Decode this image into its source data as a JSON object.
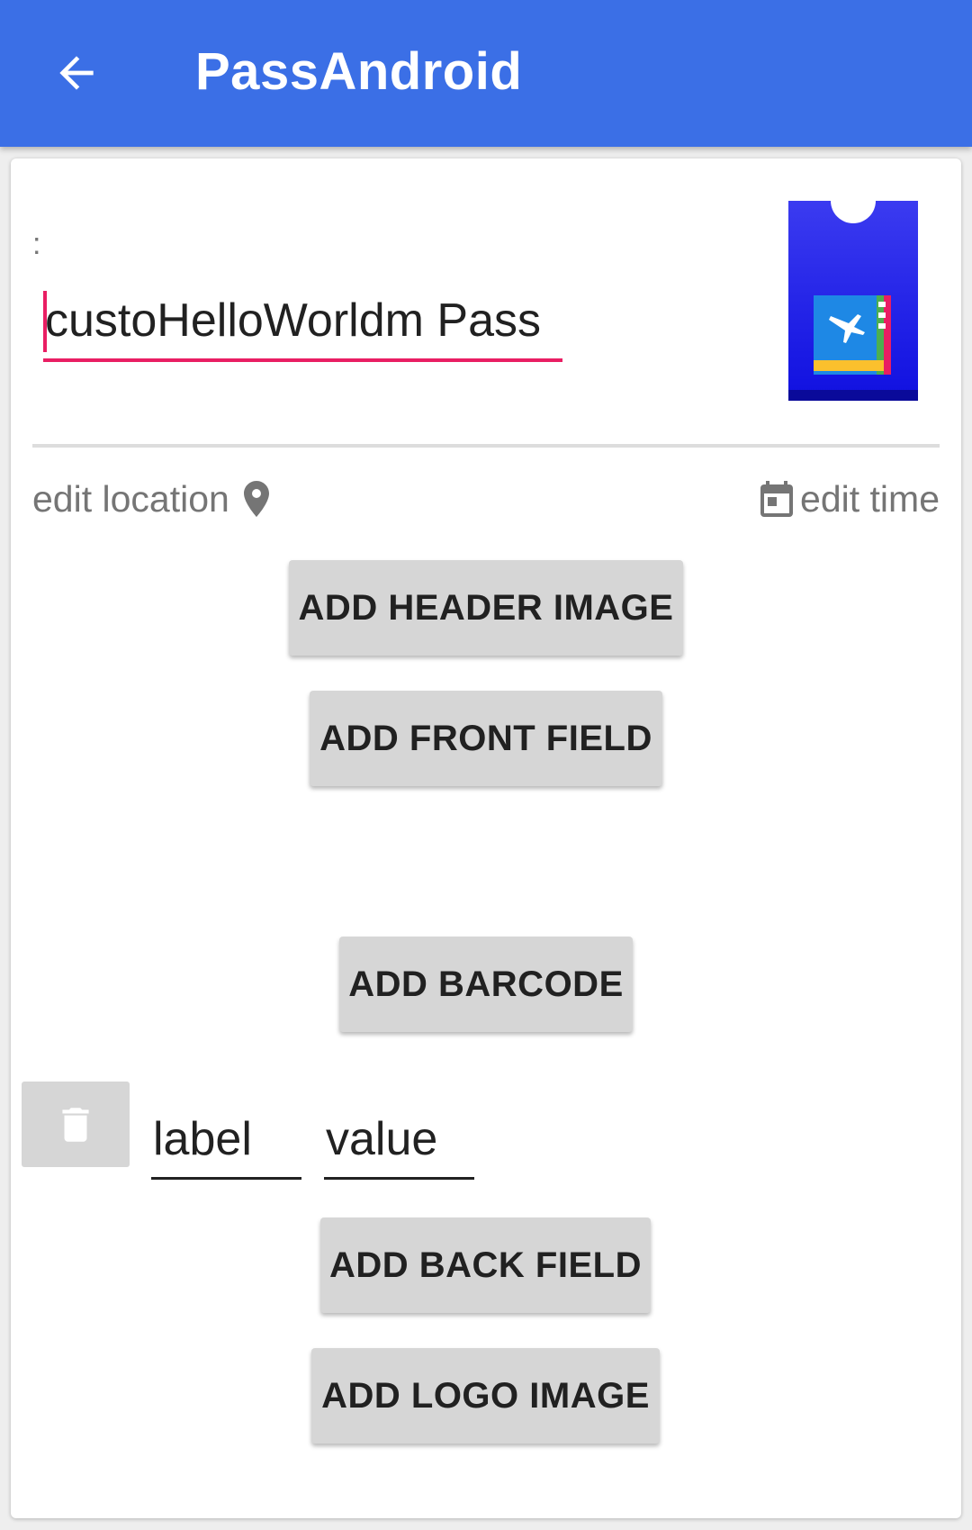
{
  "app_bar": {
    "back_icon": "arrow-back-icon",
    "title": "PassAndroid",
    "background": "#3b6fe6"
  },
  "pass": {
    "name_label": ":",
    "name_value": "custoHelloWorldm Pass",
    "accent": "#e91e63",
    "thumbnail_icon": "boarding-pass-icon"
  },
  "location": {
    "label": "edit location",
    "icon": "place-icon"
  },
  "time": {
    "label": "edit time",
    "icon": "calendar-icon"
  },
  "buttons": {
    "add_header_image": "ADD HEADER IMAGE",
    "add_front_field": "ADD FRONT FIELD",
    "add_barcode": "ADD BARCODE",
    "add_back_field": "ADD BACK FIELD",
    "add_logo_image": "ADD LOGO IMAGE"
  },
  "back_field": {
    "delete_icon": "trash-icon",
    "label": "label",
    "value": "value"
  }
}
